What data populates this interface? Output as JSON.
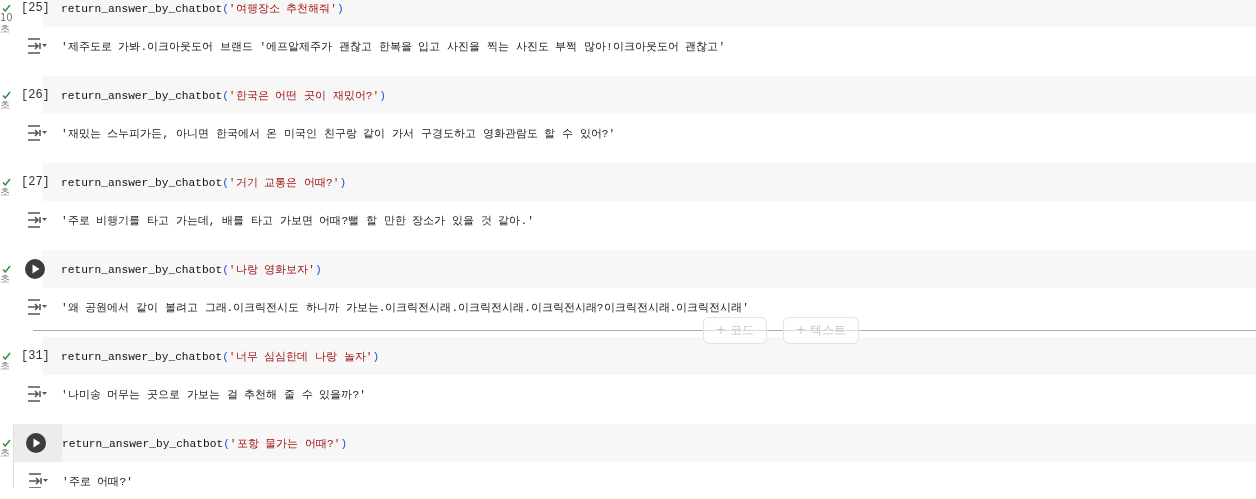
{
  "cells": [
    {
      "done": true,
      "time_value": "10",
      "time_unit": "초",
      "kind": "numbered",
      "prompt": "[25]",
      "focused": false,
      "code": [
        {
          "kind": "name",
          "text": "return_answer_by_chatbot"
        },
        {
          "kind": "paren",
          "text": "("
        },
        {
          "kind": "string",
          "text": "'여행장소 추천해줘'"
        },
        {
          "kind": "paren",
          "text": ")"
        }
      ],
      "output": "'제주도로 가봐.이크아웃도어 브랜드  '에프알제주가 괜찮고 한복을 입고 사진을 찍는 사진도 부쩍 많아!이크아웃도어 괜찮고'"
    },
    {
      "done": true,
      "time_unit": "초",
      "kind": "numbered",
      "prompt": "[26]",
      "focused": false,
      "code": [
        {
          "kind": "name",
          "text": "return_answer_by_chatbot"
        },
        {
          "kind": "paren",
          "text": "("
        },
        {
          "kind": "string",
          "text": "'한국은 어떤 곳이 재밌어?'"
        },
        {
          "kind": "paren",
          "text": ")"
        }
      ],
      "output": "'재밌는 스누피가든, 아니면 한국에서 온 미국인 친구랑 같이 가서 구경도하고 영화관람도 할 수 있어?'"
    },
    {
      "done": true,
      "time_unit": "초",
      "kind": "numbered",
      "prompt": "[27]",
      "focused": false,
      "code": [
        {
          "kind": "name",
          "text": "return_answer_by_chatbot"
        },
        {
          "kind": "paren",
          "text": "("
        },
        {
          "kind": "string",
          "text": "'거기 교통은 어때?'"
        },
        {
          "kind": "paren",
          "text": ")"
        }
      ],
      "output": "'주로 비행기를 타고 가는데, 배를 타고 가보면 어때?뻘 할 만한 장소가 있을 것 같아.'"
    },
    {
      "done": true,
      "time_unit": "초",
      "kind": "run",
      "focused": false,
      "code": [
        {
          "kind": "name",
          "text": "return_answer_by_chatbot"
        },
        {
          "kind": "paren",
          "text": "("
        },
        {
          "kind": "string",
          "text": "'나랑 영화보자'"
        },
        {
          "kind": "paren",
          "text": ")"
        }
      ],
      "output": "'왜 공원에서 같이 볼려고 그래.이크릭전시도 하니까 가보는.이크릭전시래.이크릭전시래.이크릭전시래?이크릭전시래.이크릭전시래'",
      "insert_buttons": [
        "+ 코드",
        "+ 텍스트"
      ]
    },
    {
      "done": true,
      "time_unit": "초",
      "kind": "numbered",
      "prompt": "[31]",
      "focused": false,
      "code": [
        {
          "kind": "name",
          "text": "return_answer_by_chatbot"
        },
        {
          "kind": "paren",
          "text": "("
        },
        {
          "kind": "string",
          "text": "'너무 심심한데 나랑 놀자'"
        },
        {
          "kind": "paren",
          "text": ")"
        }
      ],
      "output": "'나미송 머무는 곳으로 가보는 걸 추천해 줄 수 있을까?'"
    },
    {
      "done": true,
      "time_unit": "초",
      "kind": "run",
      "focused": true,
      "code": [
        {
          "kind": "name",
          "text": "return_answer_by_chatbot"
        },
        {
          "kind": "paren",
          "text": "("
        },
        {
          "kind": "string",
          "text": "'포항 물가는 어때?'"
        },
        {
          "kind": "paren",
          "text": ")"
        }
      ],
      "output": "'주로 어때?'"
    }
  ]
}
